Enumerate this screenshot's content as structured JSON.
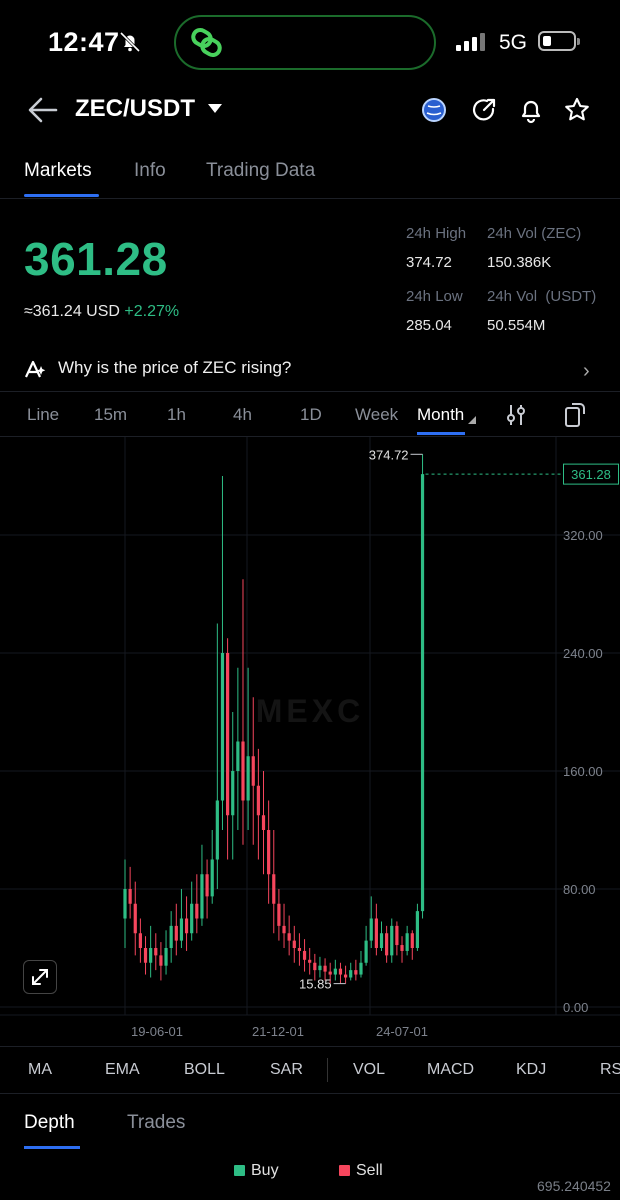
{
  "status_bar": {
    "time": "12:47",
    "network": "5G",
    "icons": [
      "bell-off-icon",
      "signal-icon",
      "battery-icon",
      "link-icon"
    ]
  },
  "header": {
    "pair": "ZEC/USDT",
    "icons": [
      "back-arrow-icon",
      "globe-icon",
      "share-icon",
      "bell-icon",
      "star-icon"
    ]
  },
  "tabs": [
    "Markets",
    "Info",
    "Trading Data"
  ],
  "price": {
    "last": "361.28",
    "usd": "≈361.24 USD",
    "change": "+2.27%",
    "stats": [
      {
        "label": "24h High",
        "value": "374.72"
      },
      {
        "label": "24h Vol (ZEC)",
        "value": "150.386K"
      },
      {
        "label": "24h Low",
        "value": "285.04"
      },
      {
        "label": "24h Vol  (USDT)",
        "value": "50.554M"
      }
    ]
  },
  "news": {
    "text": "Why is the price of ZEC rising?"
  },
  "intervals": [
    "Line",
    "15m",
    "1h",
    "4h",
    "1D",
    "Week",
    "Month"
  ],
  "active_interval": "Month",
  "chart": {
    "watermark": "MEXC",
    "y_ticks": [
      "320.00",
      "240.00",
      "160.00",
      "80.00",
      "0.00"
    ],
    "x_ticks": [
      "19-06-01",
      "21-12-01",
      "24-07-01"
    ],
    "high_label": "374.72",
    "low_label": "15.85",
    "last_label": "361.28",
    "up_color": "#2ebd85",
    "down_color": "#f6465d"
  },
  "chart_data": {
    "type": "candlestick",
    "ylim": [
      0,
      400
    ],
    "y_ticks": [
      0,
      80,
      160,
      240,
      320
    ],
    "x_ticks": [
      "19-06-01",
      "21-12-01",
      "24-07-01"
    ],
    "max_marker": 374.72,
    "min_marker": 15.85,
    "last_price": 361.28
  },
  "indicators": [
    "MA",
    "EMA",
    "BOLL",
    "SAR",
    "VOL",
    "MACD",
    "KDJ",
    "RS"
  ],
  "bottom_tabs": [
    "Depth",
    "Trades"
  ],
  "legend": {
    "buy": "Buy",
    "sell": "Sell"
  },
  "footer_number": "695.240452"
}
